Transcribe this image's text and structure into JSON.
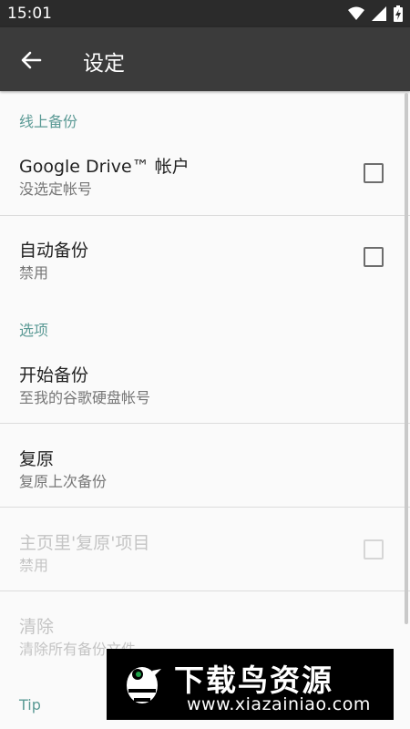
{
  "status_bar": {
    "time": "15:01"
  },
  "toolbar": {
    "title": "设定"
  },
  "sections": {
    "online_backup": {
      "header": "线上备份",
      "google_drive": {
        "title": "Google Drive™ 帐户",
        "summary": "没选定帐号",
        "checked": false
      },
      "auto_backup": {
        "title": "自动备份",
        "summary": "禁用",
        "checked": false
      }
    },
    "options": {
      "header": "选项",
      "start_backup": {
        "title": "开始备份",
        "summary": "至我的谷歌硬盘帐号"
      },
      "restore": {
        "title": "复原",
        "summary": "复原上次备份"
      },
      "home_restore": {
        "title": "主页里'复原'项目",
        "summary": "禁用",
        "checked": false,
        "enabled": false
      },
      "clear": {
        "title": "清除",
        "summary": "清除所有备份文件",
        "enabled": false
      }
    },
    "tip": {
      "header": "Tip"
    }
  },
  "watermark": {
    "title": "下载鸟资源",
    "url": "www.xiazainiao.com"
  },
  "colors": {
    "accent": "#5b9a95",
    "toolbar": "#3b3b3b",
    "status_bar": "#2b2b2b"
  }
}
